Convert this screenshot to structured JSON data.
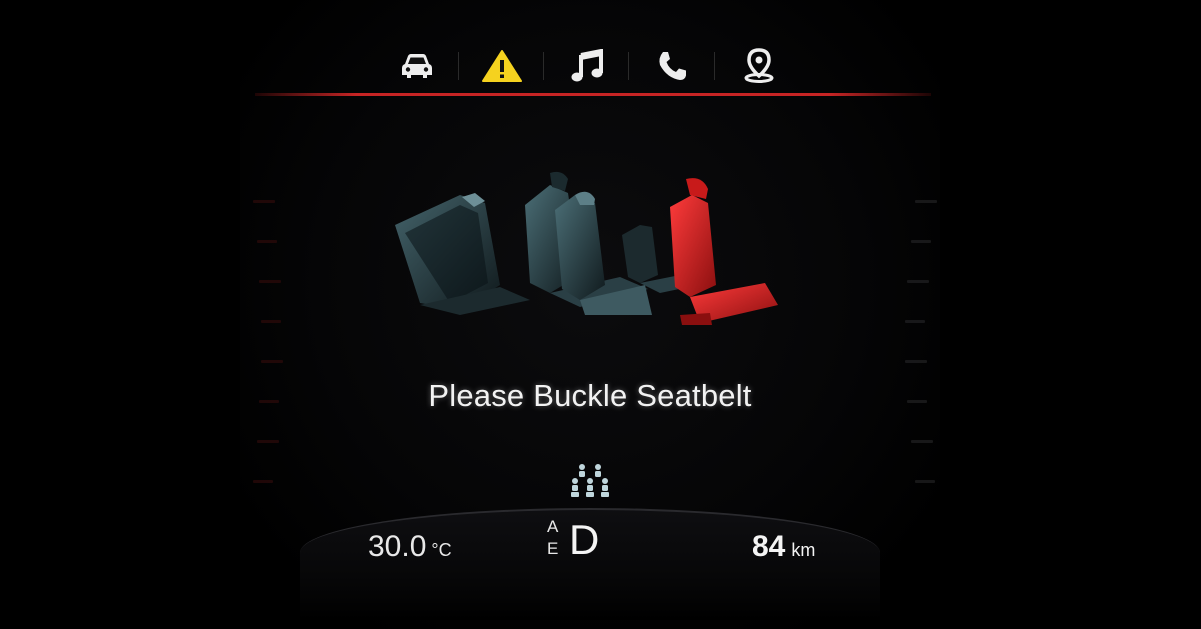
{
  "menu": {
    "items": [
      {
        "icon": "car-icon",
        "label": "Vehicle"
      },
      {
        "icon": "warning-icon",
        "label": "Warnings",
        "active": true
      },
      {
        "icon": "music-note-icon",
        "label": "Audio"
      },
      {
        "icon": "phone-icon",
        "label": "Phone"
      },
      {
        "icon": "map-pin-icon",
        "label": "Navigation"
      }
    ],
    "accent_color": "#c62424",
    "warning_color": "#f5d21f"
  },
  "seats": {
    "occupied_unbuckled_color": "#e01e1e",
    "inactive_color": "#3a5a62"
  },
  "message": "Please Buckle Seatbelt",
  "status": {
    "temperature_value": "30.0",
    "temperature_unit": "°C",
    "gear_top": "A",
    "gear_bottom": "E",
    "gear": "D",
    "distance_value": "84",
    "distance_unit": "km"
  }
}
